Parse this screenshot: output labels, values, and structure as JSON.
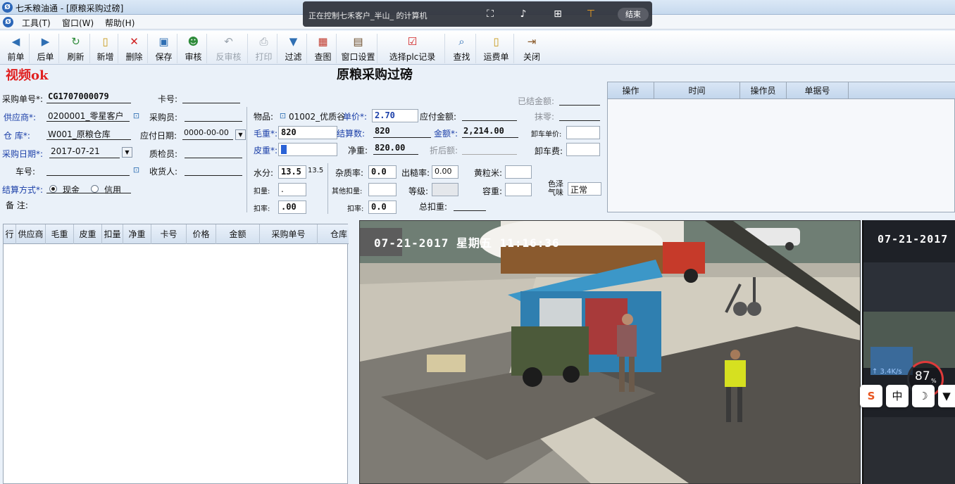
{
  "window": {
    "app_icon_glyph": "Ø",
    "title": "七禾粮油通 - [原粮采购过磅]"
  },
  "menu": {
    "items": [
      "工具(T)",
      "窗口(W)",
      "帮助(H)"
    ]
  },
  "remote_overlay": {
    "text": "正在控制七禾客户_半山_    的计算机",
    "icons": [
      "fullscreen-icon",
      "volume-icon",
      "add-icon",
      "pin-icon"
    ],
    "end_label": "结束"
  },
  "toolbar": {
    "buttons": [
      {
        "label": "前单",
        "icon": "prev-record-icon",
        "glyph": "◀",
        "enabled": true
      },
      {
        "label": "后单",
        "icon": "next-record-icon",
        "glyph": "▶",
        "enabled": true
      },
      {
        "label": "刷新",
        "icon": "refresh-icon",
        "glyph": "↻",
        "enabled": true
      },
      {
        "label": "新增",
        "icon": "new-doc-icon",
        "glyph": "▯",
        "enabled": true
      },
      {
        "label": "删除",
        "icon": "delete-icon",
        "glyph": "✕",
        "enabled": true
      },
      {
        "label": "保存",
        "icon": "save-icon",
        "glyph": "▣",
        "enabled": true
      },
      {
        "label": "审核",
        "icon": "approve-icon",
        "glyph": "☻",
        "enabled": true
      },
      {
        "label": "反审核",
        "icon": "unapprove-icon",
        "glyph": "↶",
        "enabled": false
      },
      {
        "label": "打印",
        "icon": "print-icon",
        "glyph": "⎙",
        "enabled": false
      },
      {
        "label": "过滤",
        "icon": "filter-icon",
        "glyph": "▼",
        "enabled": true
      },
      {
        "label": "查图",
        "icon": "view-image-icon",
        "glyph": "▦",
        "enabled": true
      },
      {
        "label": "窗口设置",
        "icon": "window-settings-icon",
        "glyph": "▤",
        "enabled": true
      },
      {
        "label": "选择plc记录",
        "icon": "select-plc-icon",
        "glyph": "☑",
        "enabled": true
      },
      {
        "label": "查找",
        "icon": "search-icon",
        "glyph": "⌕",
        "enabled": true
      },
      {
        "label": "运费单",
        "icon": "freight-doc-icon",
        "glyph": "▯",
        "enabled": true
      },
      {
        "label": "关闭",
        "icon": "close-icon",
        "glyph": "⇥",
        "enabled": true
      }
    ]
  },
  "status": {
    "video": "视频ok"
  },
  "form": {
    "title": "原粮采购过磅",
    "labels": {
      "order_no": "采购单号*:",
      "card_no": "卡号:",
      "supplier": "供应商*:",
      "buyer": "采购员:",
      "warehouse": "仓 库*:",
      "due_date": "应付日期:",
      "purchase_date": "采购日期*:",
      "inspector": "质检员:",
      "plate": "车号:",
      "receiver": "收货人:",
      "settle_mode": "结算方式*:",
      "cash": "现金",
      "credit": "信用",
      "remark": "备 注:",
      "goods": "物品:",
      "unit_price": "单价*:",
      "payable": "应付金额:",
      "gross": "毛重*:",
      "settle_qty": "结算数:",
      "amount": "金额*:",
      "tare": "皮重*:",
      "net": "净重:",
      "discount_amount": "折后额:",
      "settled_amount": "已结金额:",
      "rounding": "抹零:",
      "unload_price": "卸车单价:",
      "unload_fee": "卸车费:",
      "moisture": "水分:",
      "impurity": "杂质率:",
      "milling_rate": "出糙率:",
      "yellow_rice": "黄粒米:",
      "deduct_weight": "扣量:",
      "other_deduct": "其他扣量:",
      "grade": "等级:",
      "bulk_density": "容重:",
      "color_smell": "色泽气味",
      "deduct_rate": "扣率:",
      "deduct_rate2": "扣率:",
      "total_deduct": "总扣重:"
    },
    "values": {
      "order_no": "CG1707000079",
      "card_no": "",
      "supplier": "0200001_零星客户",
      "buyer": "",
      "warehouse": "W001_原粮仓库",
      "due_date": "0000-00-00",
      "purchase_date": "2017-07-21",
      "inspector": "",
      "plate": "",
      "receiver": "",
      "goods": "01002_优质谷",
      "unit_price": "2.70",
      "payable": "",
      "gross": "820",
      "settle_qty": "820",
      "amount": "2,214.00",
      "tare": "",
      "net": "820.00",
      "discount_amount": "",
      "settled_amount": "",
      "rounding": "",
      "unload_price": "",
      "unload_fee": "",
      "moisture": "13.5",
      "moisture_std": "13.5",
      "impurity": "0.0",
      "milling_rate": "0.00",
      "yellow_rice": "",
      "deduct_weight": ".",
      "other_deduct": "",
      "grade": "",
      "bulk_density": "",
      "color_smell": "正常",
      "deduct_rate": ".00",
      "deduct_rate2": "0.0",
      "total_deduct": ""
    }
  },
  "log_table": {
    "columns": [
      "操作",
      "时间",
      "操作员",
      "单据号"
    ]
  },
  "detail_grid": {
    "columns": [
      "行",
      "供应商",
      "毛重",
      "皮重",
      "扣量",
      "净重",
      "卡号",
      "价格",
      "金额",
      "采购单号",
      "仓库"
    ]
  },
  "cameras": [
    {
      "timestamp": "07-21-2017 星期五 11:16:36"
    },
    {
      "timestamp": "07-21-2017",
      "net_speed": "↑ 3.4K/s",
      "gauge_value": "87",
      "gauge_unit": "%"
    }
  ],
  "ime_toolbar": [
    {
      "icon": "sogou-ime-icon",
      "glyph": "S"
    },
    {
      "icon": "chinese-mode-icon",
      "glyph": "中"
    },
    {
      "icon": "moon-icon",
      "glyph": "☽"
    },
    {
      "icon": "skin-icon",
      "glyph": "▼"
    }
  ],
  "colors": {
    "accent_blue": "#1b3fa8",
    "video_ok_red": "#e02020",
    "caret_blue": "#2a62d6"
  }
}
